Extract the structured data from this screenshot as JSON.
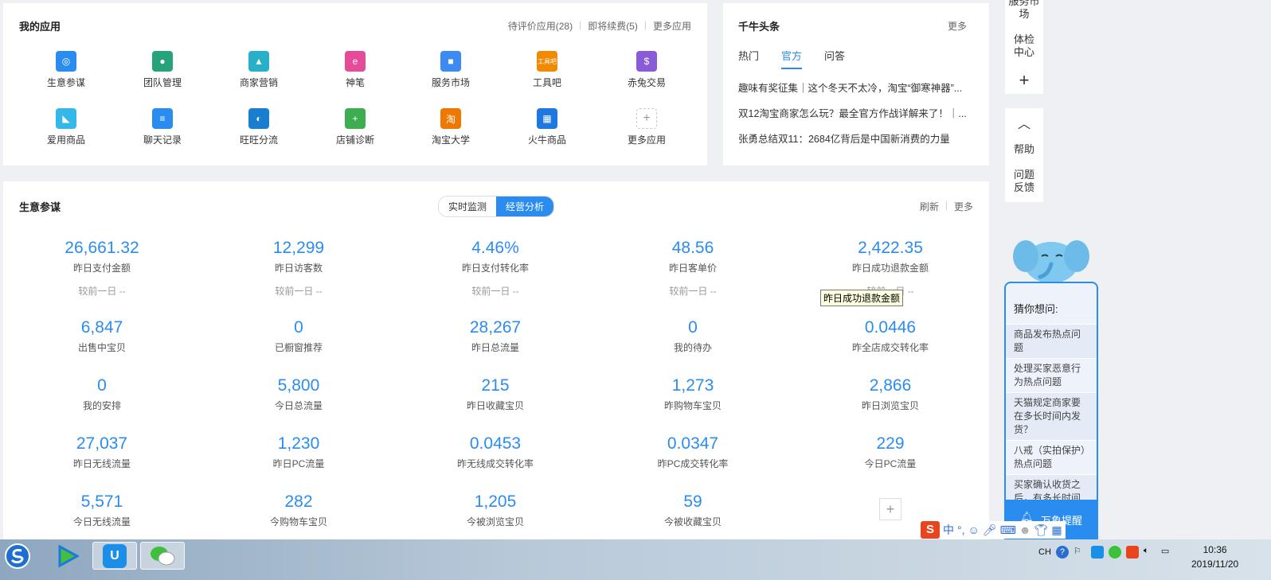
{
  "apps": {
    "title": "我的应用",
    "links": [
      "待评价应用(28)",
      "即将续费(5)",
      "更多应用"
    ],
    "items": [
      {
        "label": "生意参谋",
        "icon": "compass-icon",
        "color": "#2b8cf0",
        "glyph": "◎"
      },
      {
        "label": "团队管理",
        "icon": "team-icon",
        "color": "#27a37a",
        "glyph": "●"
      },
      {
        "label": "商家营销",
        "icon": "marketing-icon",
        "color": "#28b0c8",
        "glyph": "▲"
      },
      {
        "label": "神笔",
        "icon": "pen-icon",
        "color": "#e64b9a",
        "glyph": "e"
      },
      {
        "label": "服务市场",
        "icon": "bag-icon",
        "color": "#3d8bf0",
        "glyph": "■"
      },
      {
        "label": "工具吧",
        "icon": "tools-icon",
        "color": "#f08a00",
        "glyph": "工具吧"
      },
      {
        "label": "赤兔交易",
        "icon": "money-bag-icon",
        "color": "#8a5bd8",
        "glyph": "$"
      },
      {
        "label": "爱用商品",
        "icon": "product-icon",
        "color": "#35b8e8",
        "glyph": "◣"
      },
      {
        "label": "聊天记录",
        "icon": "chat-log-icon",
        "color": "#2b8cf0",
        "glyph": "≡"
      },
      {
        "label": "旺旺分流",
        "icon": "wangwang-icon",
        "color": "#1a7ed0",
        "glyph": "◐"
      },
      {
        "label": "店铺诊断",
        "icon": "diagnosis-icon",
        "color": "#3cae50",
        "glyph": "+"
      },
      {
        "label": "淘宝大学",
        "icon": "university-icon",
        "color": "#f07800",
        "glyph": "淘"
      },
      {
        "label": "火牛商品",
        "icon": "grid-icon",
        "color": "#1e78e0",
        "glyph": "▦"
      },
      {
        "label": "更多应用",
        "icon": "plus-icon",
        "color": "#ffffff",
        "glyph": "+"
      }
    ]
  },
  "news": {
    "title": "千牛头条",
    "more": "更多",
    "tabs": [
      "热门",
      "官方",
      "问答"
    ],
    "active_tab": 1,
    "items": [
      "趣味有奖征集｜这个冬天不太冷，淘宝“御寒神器”...",
      "双12淘宝商家怎么玩？最全官方作战详解来了！｜...",
      "张勇总结双11：2684亿背后是中国新消费的力量"
    ]
  },
  "biz": {
    "title": "生意参谋",
    "toggle": [
      "实时监测",
      "经营分析"
    ],
    "active_toggle": 1,
    "actions": [
      "刷新",
      "更多"
    ],
    "compare_text": "较前一日 --",
    "metrics": [
      {
        "value": "26,661.32",
        "label": "昨日支付金额"
      },
      {
        "value": "12,299",
        "label": "昨日访客数"
      },
      {
        "value": "4.46%",
        "label": "昨日支付转化率"
      },
      {
        "value": "48.56",
        "label": "昨日客单价"
      },
      {
        "value": "2,422.35",
        "label": "昨日成功退款金额"
      },
      {
        "value": "6,847",
        "label": "出售中宝贝"
      },
      {
        "value": "0",
        "label": "已橱窗推荐"
      },
      {
        "value": "28,267",
        "label": "昨日总流量"
      },
      {
        "value": "0",
        "label": "我的待办"
      },
      {
        "value": "0.0446",
        "label": "昨全店成交转化率"
      },
      {
        "value": "0",
        "label": "我的安排"
      },
      {
        "value": "5,800",
        "label": "今日总流量"
      },
      {
        "value": "215",
        "label": "昨日收藏宝贝"
      },
      {
        "value": "1,273",
        "label": "昨购物车宝贝"
      },
      {
        "value": "2,866",
        "label": "昨日浏览宝贝"
      },
      {
        "value": "27,037",
        "label": "昨日无线流量"
      },
      {
        "value": "1,230",
        "label": "昨日PC流量"
      },
      {
        "value": "0.0453",
        "label": "昨无线成交转化率"
      },
      {
        "value": "0.0347",
        "label": "昨PC成交转化率"
      },
      {
        "value": "229",
        "label": "今日PC流量"
      },
      {
        "value": "5,571",
        "label": "今日无线流量"
      },
      {
        "value": "282",
        "label": "今购物车宝贝"
      },
      {
        "value": "1,205",
        "label": "今被浏览宝贝"
      },
      {
        "value": "59",
        "label": "今被收藏宝贝"
      }
    ],
    "tooltip": "昨日成功退款金额"
  },
  "sidebar": {
    "top_links": [
      "服务市场",
      "体检中心"
    ],
    "bottom_links": [
      "帮助",
      "问题反馈"
    ]
  },
  "assistant": {
    "title": "猜你想问:",
    "questions": [
      "商品发布热点问题",
      "处理买家恶意行为热点问题",
      "天猫规定商家要在多长时间内发货？",
      "八戒（实拍保护）热点问题",
      "买家确认收货之后，有多长时间可以申请售后？"
    ],
    "footer": "万象提醒"
  },
  "ime": {
    "lang": "中",
    "punct": "°,"
  },
  "taskbar": {
    "input_lang": "CH",
    "time": "10:36",
    "date": "2019/11/20"
  }
}
